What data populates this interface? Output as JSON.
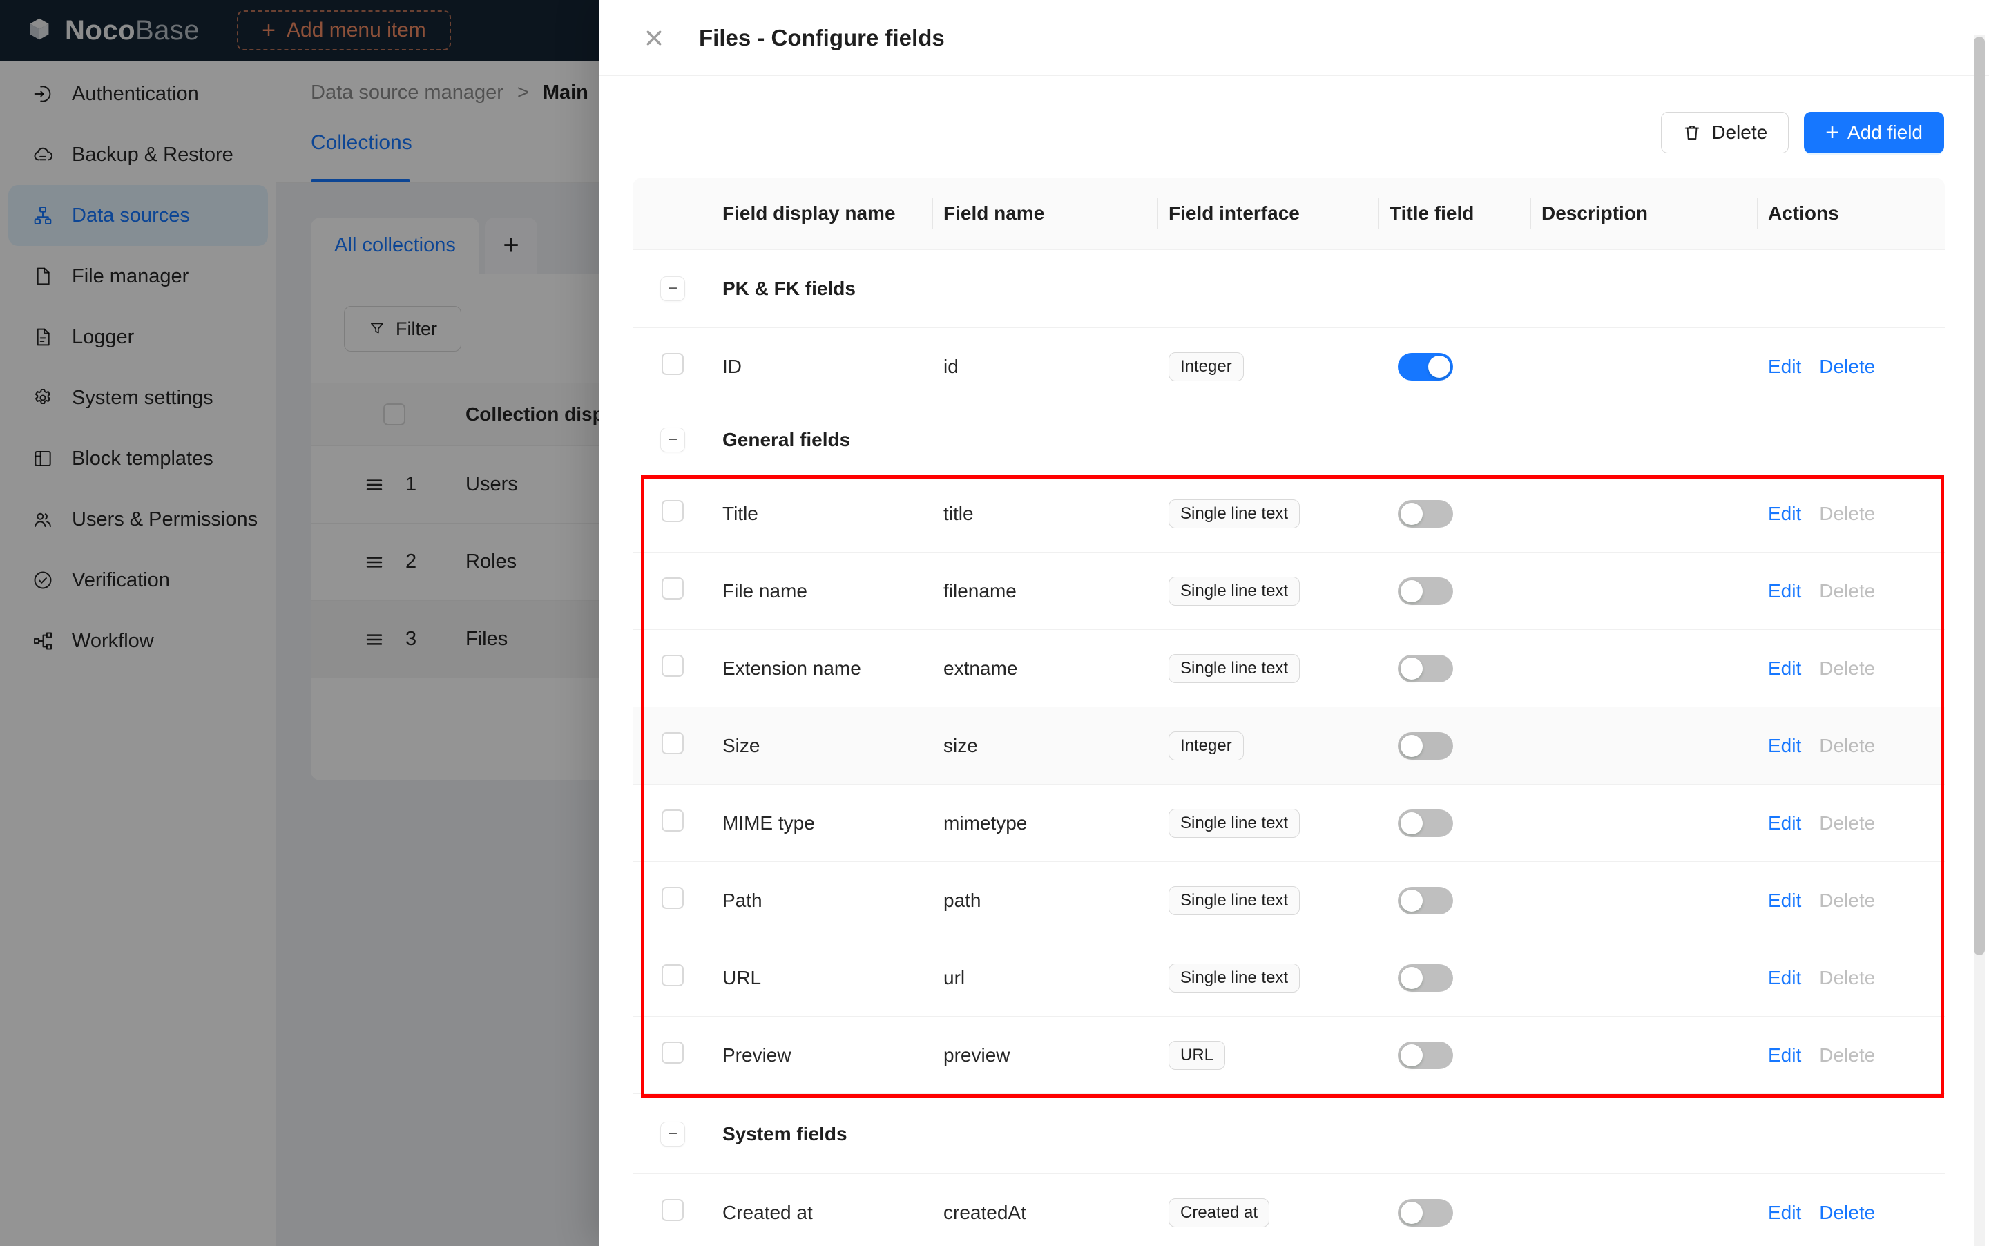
{
  "topbar": {
    "logo_primary": "Noco",
    "logo_secondary": "Base",
    "add_plus": "+",
    "add_menu_item": "Add menu item"
  },
  "sidebar": {
    "items": [
      {
        "label": "Authentication",
        "icon": "login-icon"
      },
      {
        "label": "Backup & Restore",
        "icon": "cloud-backup-icon"
      },
      {
        "label": "Data sources",
        "icon": "data-sources-icon",
        "active": "true"
      },
      {
        "label": "File manager",
        "icon": "file-icon"
      },
      {
        "label": "Logger",
        "icon": "log-file-icon"
      },
      {
        "label": "System settings",
        "icon": "gear-icon"
      },
      {
        "label": "Block templates",
        "icon": "layout-icon"
      },
      {
        "label": "Users & Permissions",
        "icon": "team-icon"
      },
      {
        "label": "Verification",
        "icon": "check-circle-icon"
      },
      {
        "label": "Workflow",
        "icon": "workflow-icon"
      }
    ]
  },
  "background": {
    "breadcrumb": {
      "section": "Data source manager",
      "separator": ">",
      "current": "Main"
    },
    "page_tab": "Collections",
    "collections": {
      "active_tab": "All collections",
      "add_tab": "+",
      "filter_label": "Filter",
      "table": {
        "header": "Collection disp",
        "rows": [
          {
            "order": "1",
            "name": "Users"
          },
          {
            "order": "2",
            "name": "Roles"
          },
          {
            "order": "3",
            "name": "Files",
            "selected": "true"
          }
        ]
      }
    }
  },
  "drawer": {
    "title": "Files - Configure fields",
    "toolbar": {
      "delete_label": "Delete",
      "add_plus": "+",
      "add_field_label": "Add field"
    },
    "table": {
      "collapse_glyph": "−",
      "columns": [
        "Field display name",
        "Field name",
        "Field interface",
        "Title field",
        "Description",
        "Actions"
      ],
      "sections": [
        {
          "label": "PK & FK fields",
          "highlighted": "false",
          "rows": [
            {
              "display_name": "ID",
              "field_name": "id",
              "interface": "Integer",
              "title_field": "on",
              "description": "",
              "edit_label": "Edit",
              "delete_label": "Delete",
              "delete_enabled": "true"
            }
          ]
        },
        {
          "label": "General fields",
          "highlighted": "true",
          "rows": [
            {
              "display_name": "Title",
              "field_name": "title",
              "interface": "Single line text",
              "title_field": "off",
              "description": "",
              "edit_label": "Edit",
              "delete_label": "Delete",
              "delete_enabled": "false"
            },
            {
              "display_name": "File name",
              "field_name": "filename",
              "interface": "Single line text",
              "title_field": "off",
              "description": "",
              "edit_label": "Edit",
              "delete_label": "Delete",
              "delete_enabled": "false"
            },
            {
              "display_name": "Extension name",
              "field_name": "extname",
              "interface": "Single line text",
              "title_field": "off",
              "description": "",
              "edit_label": "Edit",
              "delete_label": "Delete",
              "delete_enabled": "false"
            },
            {
              "display_name": "Size",
              "field_name": "size",
              "interface": "Integer",
              "title_field": "off",
              "description": "",
              "edit_label": "Edit",
              "delete_label": "Delete",
              "delete_enabled": "false"
            },
            {
              "display_name": "MIME type",
              "field_name": "mimetype",
              "interface": "Single line text",
              "title_field": "off",
              "description": "",
              "edit_label": "Edit",
              "delete_label": "Delete",
              "delete_enabled": "false"
            },
            {
              "display_name": "Path",
              "field_name": "path",
              "interface": "Single line text",
              "title_field": "off",
              "description": "",
              "edit_label": "Edit",
              "delete_label": "Delete",
              "delete_enabled": "false"
            },
            {
              "display_name": "URL",
              "field_name": "url",
              "interface": "Single line text",
              "title_field": "off",
              "description": "",
              "edit_label": "Edit",
              "delete_label": "Delete",
              "delete_enabled": "false"
            },
            {
              "display_name": "Preview",
              "field_name": "preview",
              "interface": "URL",
              "title_field": "off",
              "description": "",
              "edit_label": "Edit",
              "delete_label": "Delete",
              "delete_enabled": "false"
            }
          ]
        },
        {
          "label": "System fields",
          "highlighted": "false",
          "rows": [
            {
              "display_name": "Created at",
              "field_name": "createdAt",
              "interface": "Created at",
              "title_field": "off",
              "description": "",
              "edit_label": "Edit",
              "delete_label": "Delete",
              "delete_enabled": "true"
            }
          ]
        }
      ]
    }
  },
  "colors": {
    "accent_blue": "#1677ff",
    "switch_on": "#1677ff",
    "switch_off_track": "rgba(0,0,0,0.25)",
    "highlight_border": "#ff0000",
    "topbar_bg": "#162535",
    "add_menu_item_orange": "#f18b62",
    "link_disabled": "rgba(0,0,0,0.25)"
  }
}
